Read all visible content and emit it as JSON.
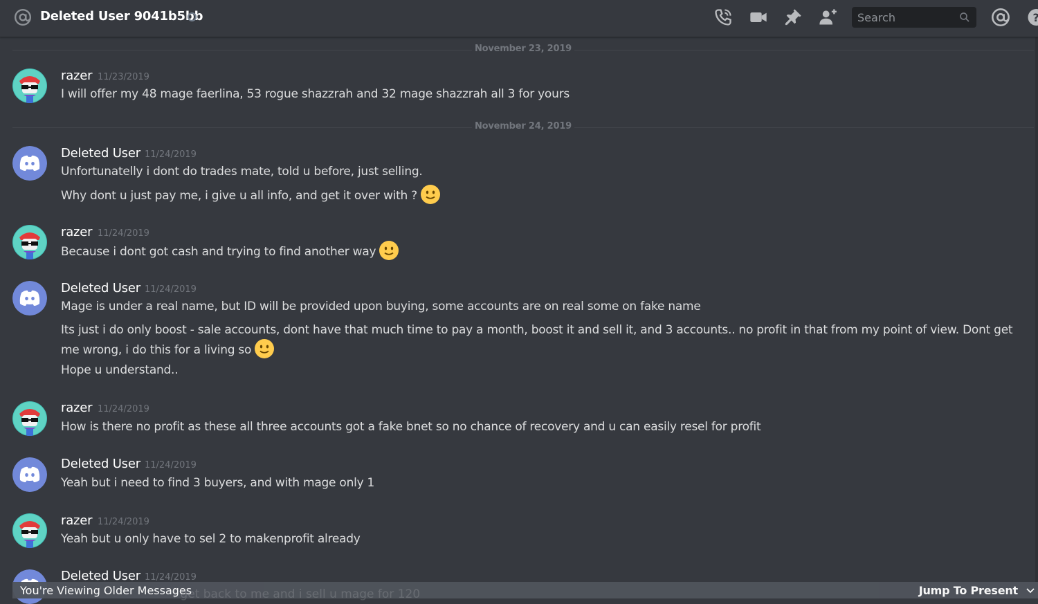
{
  "header": {
    "title": "Deleted User 9041b5bb",
    "search_placeholder": "Search",
    "icons": [
      "at-icon",
      "status-dot",
      "call-icon",
      "video-icon",
      "pin-icon",
      "add-friend-icon",
      "search-icon",
      "mentions-icon",
      "help-icon"
    ]
  },
  "dividers": [
    "November 23, 2019",
    "November 24, 2019"
  ],
  "messages": [
    {
      "author": "razer",
      "timestamp": "11/23/2019",
      "lines": [
        "I will offer my 48 mage faerlina, 53 rogue shazzrah and 32 mage shazzrah all 3 for yours"
      ]
    },
    {
      "author": "Deleted User",
      "timestamp": "11/24/2019",
      "lines": [
        "Unfortunatelly i dont do trades mate, told u before, just selling.",
        "Why dont u just pay me, i give u all info, and get it over with ?"
      ]
    },
    {
      "author": "razer",
      "timestamp": "11/24/2019",
      "lines": [
        "Because i dont got cash and trying to find another way"
      ]
    },
    {
      "author": "Deleted User",
      "timestamp": "11/24/2019",
      "lines": [
        "Mage is under a real name, but ID will be provided upon buying, some accounts are on real some on fake name",
        "Its just i do only boost - sale accounts, dont have that much time to pay a month, boost it and sell it, and 3 accounts.. no profit in that from my point of view. Dont get me wrong, i do this for a living so",
        "Hope u understand.."
      ]
    },
    {
      "author": "razer",
      "timestamp": "11/24/2019",
      "lines": [
        "How is there no profit as these all three accounts got a fake bnet so no chance of recovery and u can easily resel for profit"
      ]
    },
    {
      "author": "Deleted User",
      "timestamp": "11/24/2019",
      "lines": [
        "Yeah but i need to find 3 buyers, and with mage only 1"
      ]
    },
    {
      "author": "razer",
      "timestamp": "11/24/2019",
      "lines": [
        "Yeah but u only have to sel 2 to makenprofit already"
      ]
    },
    {
      "author": "Deleted User",
      "timestamp": "11/24/2019",
      "lines": [
        "I get back to me and i sell u mage for 120"
      ]
    }
  ],
  "bottom_bar": {
    "older_label": "You're Viewing Older Messages",
    "jump_label": "Jump To Present"
  },
  "colors": {
    "background": "#36393f",
    "header_text": "#ffffff",
    "muted": "#72767d",
    "blurple": "#7289da",
    "search_bg": "#202225",
    "bar_bg": "#4f545c"
  }
}
